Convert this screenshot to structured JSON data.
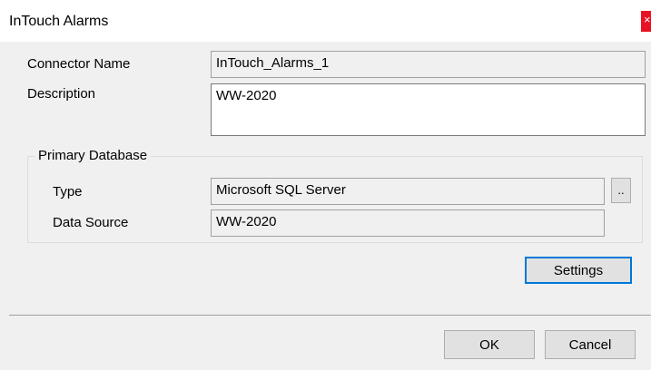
{
  "window": {
    "title": "InTouch Alarms",
    "close_glyph": "×"
  },
  "form": {
    "connector_name_label": "Connector Name",
    "connector_name_value": "InTouch_Alarms_1",
    "description_label": "Description",
    "description_value": "WW-2020"
  },
  "primary_database": {
    "group_label": "Primary Database",
    "type_label": "Type",
    "type_value": "Microsoft SQL Server",
    "browse_button_label": "..",
    "data_source_label": "Data Source",
    "data_source_value": "WW-2020"
  },
  "buttons": {
    "settings": "Settings",
    "ok": "OK",
    "cancel": "Cancel"
  },
  "colors": {
    "close_button": "#e81123",
    "default_button_border": "#0078d7"
  }
}
